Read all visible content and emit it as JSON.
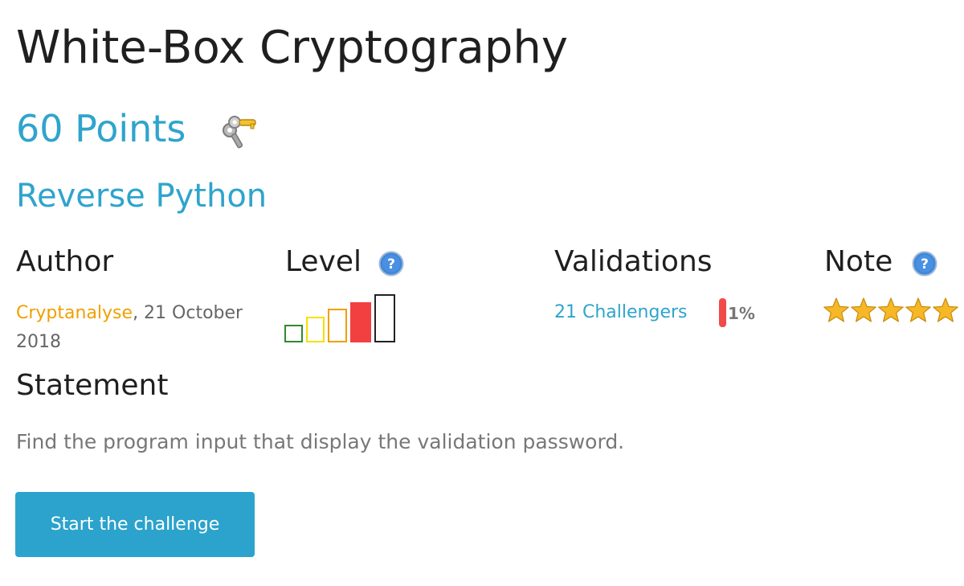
{
  "challenge": {
    "title": "White-Box Cryptography",
    "points": "60 Points",
    "category": "Reverse Python"
  },
  "author": {
    "heading": "Author",
    "name": "Cryptanalyse",
    "date_suffix": ",  21 October 2018"
  },
  "level": {
    "heading": "Level",
    "help_icon": "help-icon",
    "current": 4,
    "max": 5,
    "colors": [
      "#2e8b2e",
      "#f5e100",
      "#f0a000",
      "#f24040",
      "#222222"
    ]
  },
  "validations": {
    "heading": "Validations",
    "challengers": "21 Challengers",
    "percent_label": "1%",
    "bar_color": "#f24a4a"
  },
  "note": {
    "heading": "Note",
    "help_icon": "help-icon",
    "stars": 5,
    "max_stars": 5
  },
  "statement": {
    "heading": "Statement",
    "text": "Find the program input that display the validation password."
  },
  "actions": {
    "start_label": "Start the challenge"
  },
  "colors": {
    "accent": "#2fa4cc",
    "author_link": "#f0a000"
  }
}
